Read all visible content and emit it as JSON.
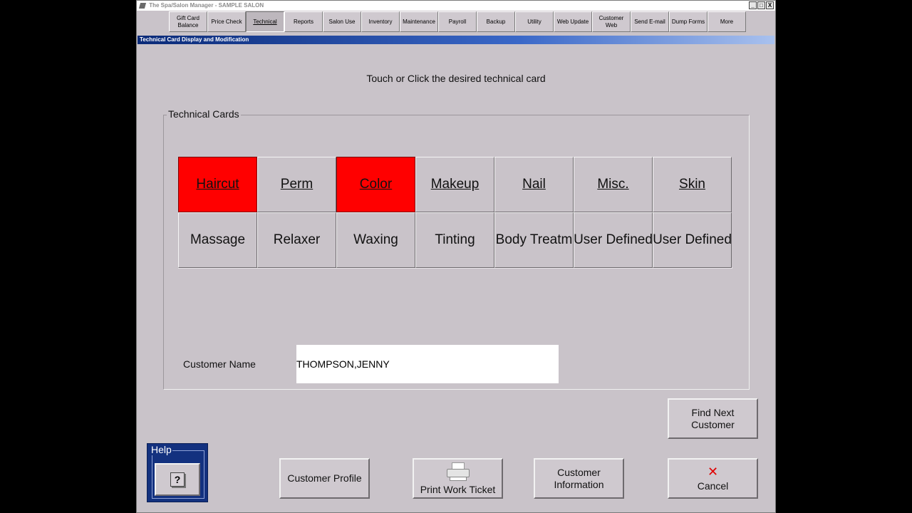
{
  "window": {
    "title": "The Spa/Salon Manager - SAMPLE SALON",
    "controls": [
      "_",
      "□",
      "X"
    ]
  },
  "toolbar": [
    {
      "label": "Gift Card Balance",
      "active": false
    },
    {
      "label": "Price Check",
      "active": false
    },
    {
      "label": "Technical",
      "active": true
    },
    {
      "label": "Reports",
      "active": false
    },
    {
      "label": "Salon Use",
      "active": false
    },
    {
      "label": "Inventory",
      "active": false
    },
    {
      "label": "Maintenance",
      "active": false
    },
    {
      "label": "Payroll",
      "active": false
    },
    {
      "label": "Backup",
      "active": false
    },
    {
      "label": "Utility",
      "active": false
    },
    {
      "label": "Web Update",
      "active": false
    },
    {
      "label": "Customer Web",
      "active": false
    },
    {
      "label": "Send E-mail",
      "active": false
    },
    {
      "label": "Dump Forms",
      "active": false
    },
    {
      "label": "More",
      "active": false
    }
  ],
  "panel": {
    "header": "Technical Card Display and Modification",
    "instruction": "Touch or Click the desired technical card",
    "group_label": "Technical Cards"
  },
  "cards": [
    {
      "label": "Haircut",
      "selected": true,
      "underline": true
    },
    {
      "label": "Perm",
      "selected": false,
      "underline": true
    },
    {
      "label": "Color",
      "selected": true,
      "underline": true
    },
    {
      "label": "Makeup",
      "selected": false,
      "underline": true
    },
    {
      "label": "Nail",
      "selected": false,
      "underline": true
    },
    {
      "label": "Misc.",
      "selected": false,
      "underline": true
    },
    {
      "label": "Skin",
      "selected": false,
      "underline": true
    },
    {
      "label": "Massage",
      "selected": false,
      "underline": false
    },
    {
      "label": "Relaxer",
      "selected": false,
      "underline": false
    },
    {
      "label": "Waxing",
      "selected": false,
      "underline": false
    },
    {
      "label": "Tinting",
      "selected": false,
      "underline": false
    },
    {
      "label": "Body Treatm",
      "selected": false,
      "underline": false
    },
    {
      "label": "User Defined",
      "selected": false,
      "underline": false
    },
    {
      "label": "User Defined",
      "selected": false,
      "underline": false
    }
  ],
  "customer": {
    "label": "Customer Name",
    "value": "THOMPSON,JENNY"
  },
  "buttons": {
    "find_next_line1": "Find Next",
    "find_next_line2": "Customer",
    "customer_profile": "Customer Profile",
    "print_work_ticket": "Print Work Ticket",
    "customer_info_line1": "Customer",
    "customer_info_line2": "Information",
    "cancel": "Cancel",
    "help_label": "Help",
    "help_icon": "?"
  },
  "colors": {
    "selected_card": "#ff0000",
    "header_blue": "#0a2a78",
    "help_panel": "#13317f"
  }
}
